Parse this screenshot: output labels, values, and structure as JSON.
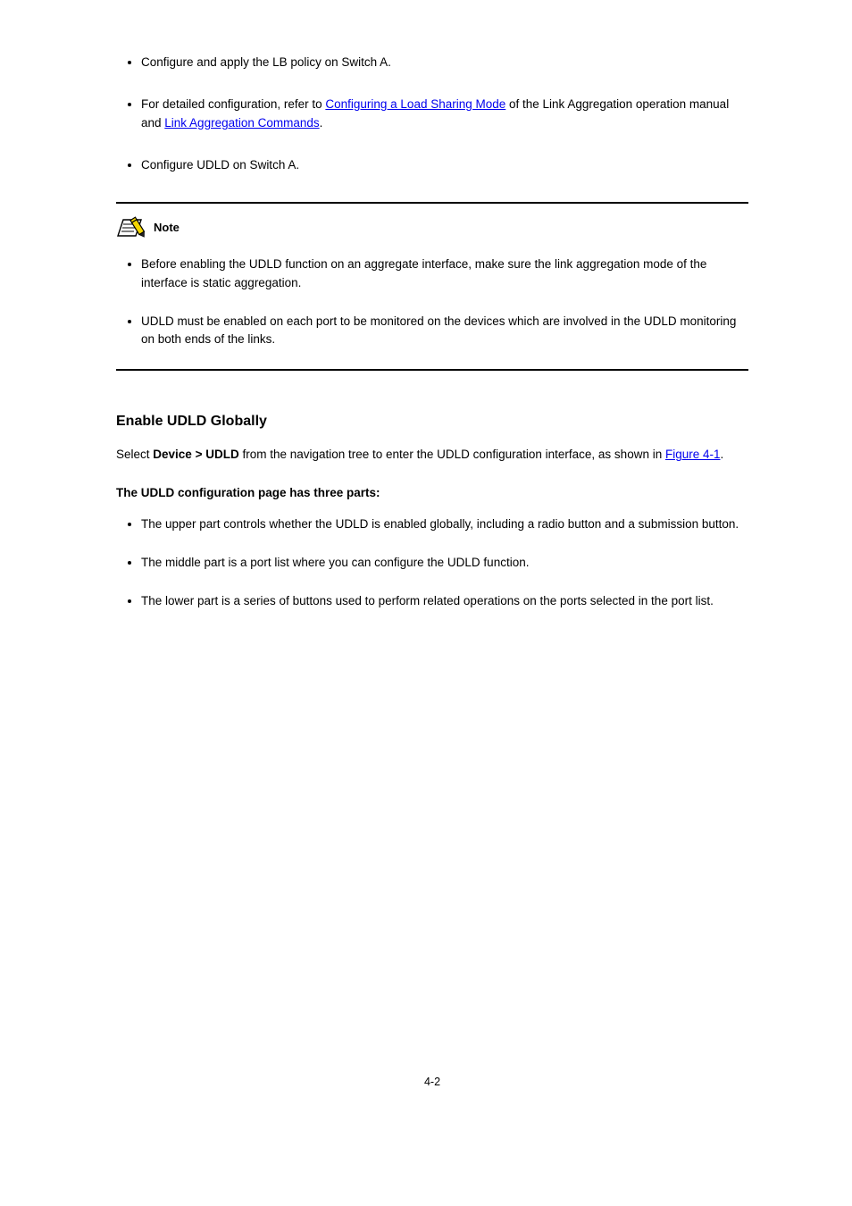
{
  "top_list": [
    {
      "text": "Configure and apply the LB policy on Switch A."
    },
    {
      "prefix": "For detailed configuration, refer to ",
      "link": "Configuring a Load Sharing Mode",
      "suffix": " of the Link Aggregation operation manual and ",
      "link2": "Link Aggregation Commands",
      "suffix2": "."
    },
    {
      "text": "Configure UDLD on Switch A."
    }
  ],
  "note_label": "Note",
  "note_list": [
    "Before enabling the UDLD function on an aggregate interface, make sure the link aggregation mode of the interface is static aggregation.",
    "UDLD must be enabled on each port to be monitored on the devices which are involved in the UDLD monitoring on both ends of the links."
  ],
  "section_title": "Enable UDLD Globally",
  "section_para_prefix": "Select ",
  "section_para_bold": "Device > UDLD",
  "section_para_mid": " from the navigation tree to enter the UDLD configuration interface, as shown in ",
  "section_para_link": "Figure 4-1",
  "section_para_suffix": ".",
  "sub_title": "The UDLD configuration page has three parts:",
  "sub_list": [
    "The upper part controls whether the UDLD is enabled globally, including a radio button and a submission button.",
    "The middle part is a port list where you can configure the UDLD function.",
    "The lower part is a series of buttons used to perform related operations on the ports selected in the port list."
  ],
  "page_number": "4-2"
}
